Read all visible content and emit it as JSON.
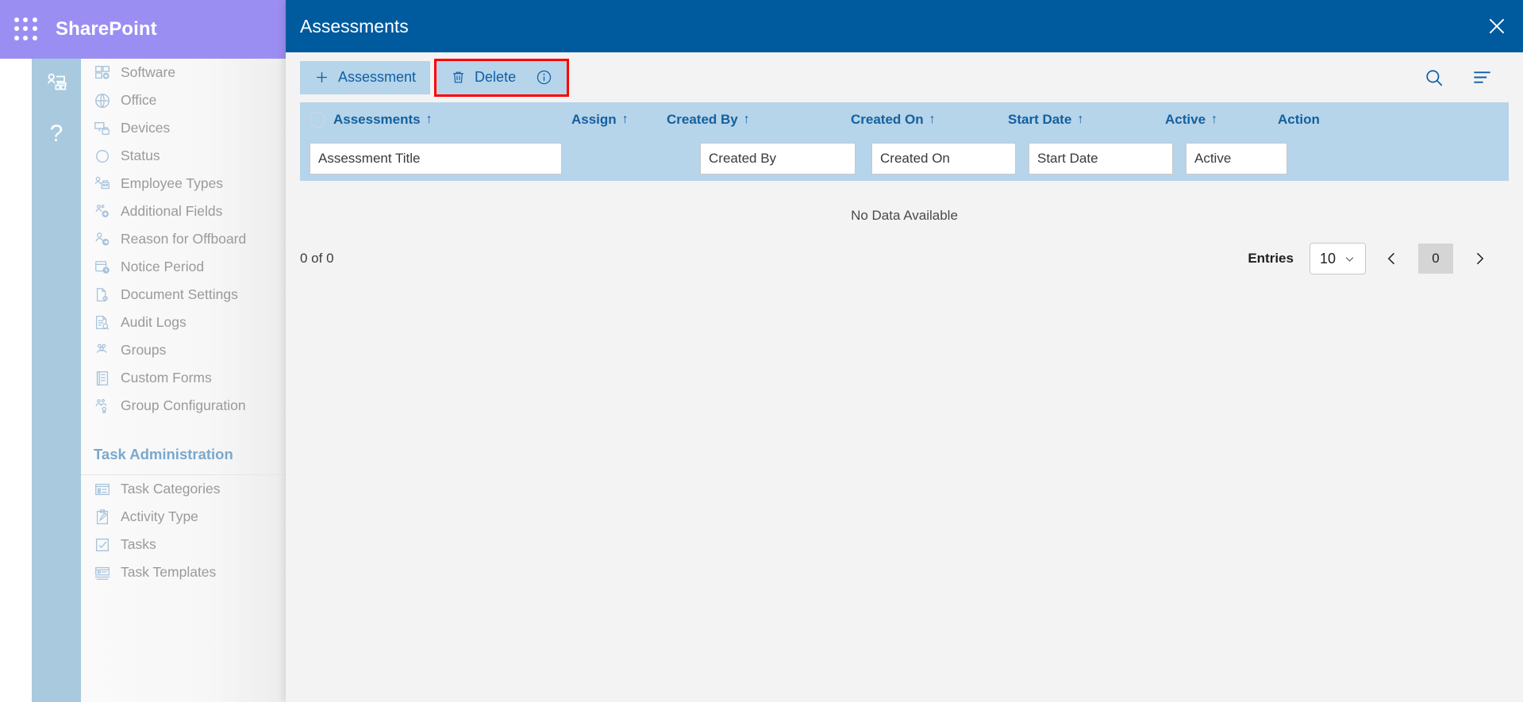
{
  "app": {
    "brand": "SharePoint",
    "waffle_icon": "app-launcher-icon",
    "rail": {
      "org_icon": "org-chart-icon",
      "help_icon": "help-question-icon"
    }
  },
  "sidebar": {
    "groups": [
      {
        "items": [
          {
            "label": "Software",
            "icon": "software-add-icon"
          },
          {
            "label": "Office",
            "icon": "globe-icon"
          },
          {
            "label": "Devices",
            "icon": "devices-icon"
          },
          {
            "label": "Status",
            "icon": "circle-status-icon"
          },
          {
            "label": "Employee Types",
            "icon": "employee-types-icon"
          },
          {
            "label": "Additional Fields",
            "icon": "additional-fields-icon"
          },
          {
            "label": "Reason for Offboard",
            "icon": "offboard-reason-icon"
          },
          {
            "label": "Notice Period",
            "icon": "notice-period-icon"
          },
          {
            "label": "Document Settings",
            "icon": "document-settings-icon"
          },
          {
            "label": "Audit Logs",
            "icon": "audit-logs-icon"
          },
          {
            "label": "Groups",
            "icon": "groups-icon"
          },
          {
            "label": "Custom Forms",
            "icon": "custom-forms-icon"
          },
          {
            "label": "Group Configuration",
            "icon": "group-configuration-icon"
          }
        ]
      }
    ],
    "section_header": "Task Administration",
    "task_items": [
      {
        "label": "Task Categories",
        "icon": "task-categories-icon"
      },
      {
        "label": "Activity Type",
        "icon": "activity-type-icon"
      },
      {
        "label": "Tasks",
        "icon": "tasks-check-icon"
      },
      {
        "label": "Task Templates",
        "icon": "task-templates-icon"
      }
    ]
  },
  "modal": {
    "title": "Assessments",
    "close_icon": "close-icon",
    "toolbar": {
      "add_label": "Assessment",
      "add_icon": "plus-icon",
      "delete_label": "Delete",
      "delete_icon": "trash-icon",
      "info_icon": "info-circle-icon",
      "search_icon": "search-icon",
      "menu_icon": "filter-menu-icon",
      "highlight_color": "#ff0000"
    },
    "grid": {
      "select_all_icon": "select-all-circle-icon",
      "sort_arrow": "↑",
      "columns": [
        {
          "label": "Assessments",
          "sortable": true
        },
        {
          "label": "Assign",
          "sortable": true
        },
        {
          "label": "Created By",
          "sortable": true
        },
        {
          "label": "Created On",
          "sortable": true
        },
        {
          "label": "Start Date",
          "sortable": true
        },
        {
          "label": "Active",
          "sortable": true
        },
        {
          "label": "Action",
          "sortable": false
        }
      ],
      "filters": [
        {
          "placeholder": "Assessment Title",
          "value": ""
        },
        {
          "placeholder": "",
          "value": "",
          "hidden": true
        },
        {
          "placeholder": "Created By",
          "value": ""
        },
        {
          "placeholder": "Created On",
          "value": ""
        },
        {
          "placeholder": "Start Date",
          "value": ""
        },
        {
          "placeholder": "Active",
          "value": ""
        }
      ],
      "empty_message": "No Data Available",
      "rows": []
    },
    "footer": {
      "count_text": "0 of 0",
      "entries_label": "Entries",
      "entries_value": "10",
      "entries_caret_icon": "chevron-down-icon",
      "prev_icon": "chevron-left-icon",
      "next_icon": "chevron-right-icon",
      "current_page": "0"
    }
  },
  "colors": {
    "brand_purple": "#9b8ef2",
    "modal_header_blue": "#005a9e",
    "accent_light_blue": "#b6d4ea",
    "rail_blue": "#a9c9de",
    "highlight_red": "#ff0000"
  }
}
